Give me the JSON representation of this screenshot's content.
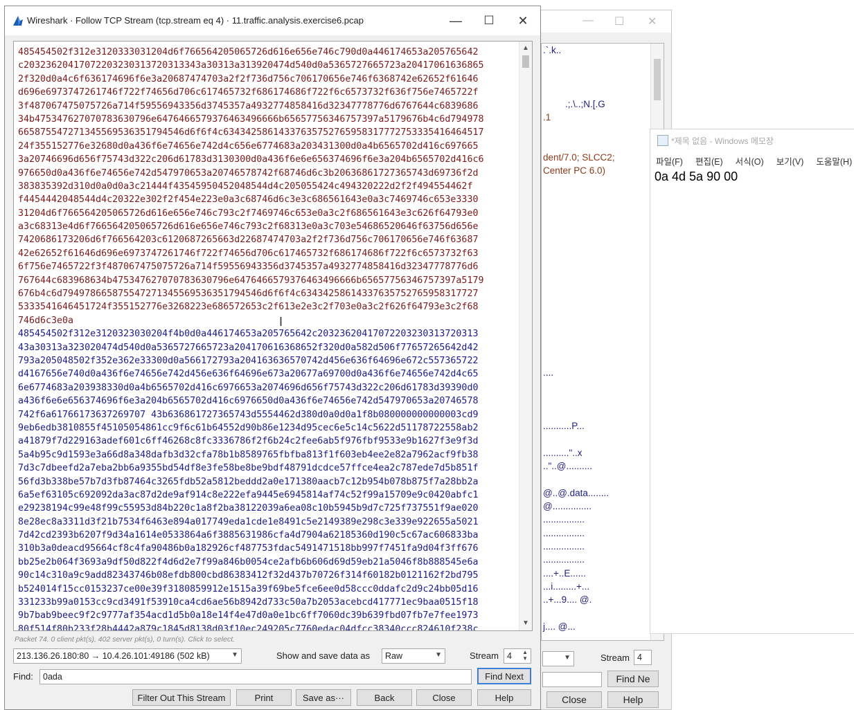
{
  "main_window": {
    "title": "Wireshark · Follow TCP Stream (tcp.stream eq 4) · 11.traffic.analysis.exercise6.pcap",
    "controls": {
      "minimize": "—",
      "maximize": "☐",
      "close": "✕"
    },
    "stream_lines": [
      {
        "side": "client",
        "text": "485454502f312e3120333031204d6f766564205065726d616e656e746c790d0a446174653a205765642"
      },
      {
        "side": "client",
        "text": "c20323620417072203230313720313343a30313a313920474d540d0a5365727665723a20417061636865"
      },
      {
        "side": "client",
        "text": "2f320d0a4c6f636174696f6e3a20687474703a2f2f736d756c706170656e746f6368742e62652f61646"
      },
      {
        "side": "client",
        "text": "d696e6973747261746f722f74656d706c617465732f686174686f722f6c6573732f636f756e7465722f"
      },
      {
        "side": "client",
        "text": "3f487067475075726a714f59556943356d3745357a4932774858416d32347778776d6767644c6839686"
      },
      {
        "side": "client",
        "text": "34b475347627070783630796e6476466579376463496666b65657756346757397a5179676b4c6d794978"
      },
      {
        "side": "client",
        "text": "665875547271345569536351794546d6f6f4c63434258614337635752765958317772753335416464517"
      },
      {
        "side": "client",
        "text": "24f355152776e32680d0a436f6e74656e742d4c656e6774683a203431300d0a4b6565702d416c697665"
      },
      {
        "side": "client",
        "text": "3a20746696d656f75743d322c206d61783d3130300d0a436f6e6e656374696f6e3a204b6565702d416c6"
      },
      {
        "side": "client",
        "text": "976650d0a436f6e74656e742d547970653a20746578742f68746d6c3b20636861727365743d69736f2d"
      },
      {
        "side": "client",
        "text": "383835392d310d0a0d0a3c21444f43545950452048544d4c205055424c494320222d2f2f494554462f"
      },
      {
        "side": "client",
        "text": "f4454442048544d4c20322e302f2f454e223e0a3c68746d6c3e3c686561643e0a3c7469746c653e3330"
      },
      {
        "side": "client",
        "text": "31204d6f766564205065726d616e656e746c793c2f7469746c653e0a3c2f686561643e3c626f64793e0"
      },
      {
        "side": "client",
        "text": "a3c68313e4d6f766564205065726d616e656e746c793c2f68313e0a3c703e54686520646f63756d656e"
      },
      {
        "side": "client",
        "text": "7420686173206d6f766564203c6120687265663d22687474703a2f2f736d756c706170656e746f63687"
      },
      {
        "side": "client",
        "text": "42e62652f61646d696e6973747261746f722f74656d706c617465732f686174686f722f6c6573732f63"
      },
      {
        "side": "client",
        "text": "6f756e7465722f3f487067475075726a714f59556943356d3745357a4932774858416d32347778776d6"
      },
      {
        "side": "client",
        "text": "767644c683968634b475347627070783630796e6476466579376463496666b65657756346757397a5179"
      },
      {
        "side": "client",
        "text": "676b4c6d794978665875547271345569536351794546d6f6f4c63434258614337635752765958317727"
      },
      {
        "side": "client",
        "text": "5333541646451724f355152776e3268223e686572653c2f613e2e3c2f703e0a3c2f626f64793e3c2f68"
      },
      {
        "side": "client",
        "text": "746d6c3e0a"
      },
      {
        "side": "server",
        "text": "485454502f312e3120323030204f4b0d0a446174653a205765642c20323620417072203230313720313"
      },
      {
        "side": "server",
        "text": "43a30313a323020474d540d0a5365727665723a204170616368652f320d0a582d506f77657265642d42"
      },
      {
        "side": "server",
        "text": "793a205048502f352e362e33300d0a566172793a204163636570742d456e636f64696e672c557365722"
      },
      {
        "side": "server",
        "text": "d4167656e740d0a436f6e74656e742d456e636f64696e673a20677a69700d0a436f6e74656e742d4c65"
      },
      {
        "side": "server",
        "text": "6e6774683a203938330d0a4b6565702d416c6976653a2074696d656f75743d322c206d61783d39390d0"
      },
      {
        "side": "server",
        "text": "a436f6e6e656374696f6e3a204b6565702d416c6976650d0a436f6e74656e742d547970653a20746578"
      },
      {
        "side": "server",
        "text": "742f6a61766173637269707 43b636861727365743d5554462d380d0a0d0a1f8b080000000000003cd9"
      },
      {
        "side": "server",
        "text": "9eb6edb3810855f45105054861cc9f6c61b64552d90b86e1234d95cec6e5c14c5622d51178722558ab2"
      },
      {
        "side": "server",
        "text": "a41879f7d229163adef601c6ff46268c8fc3336786f2f6b24c2fee6ab5f976fbf9533e9b1627f3e9f3d"
      },
      {
        "side": "server",
        "text": "5a4b95c9d1593e3a66d8a348dafb3d32cfa78b1b8589765fbfba813f1f603eb4ee2e82a7962acf9fb38"
      },
      {
        "side": "server",
        "text": "7d3c7dbeefd2a7eba2bb6a9355bd54df8e3fe58be8be9bdf48791dcdce57ffce4ea2c787ede7d5b851f"
      },
      {
        "side": "server",
        "text": "56fd3b338be57b7d3fb87464c3265fdb52a5812beddd2a0e171380aacb7c12b954b078b875f7a28bb2a"
      },
      {
        "side": "server",
        "text": "6a5ef63105c692092da3ac87d2de9af914c8e222efa9445e6945814af74c52f99a15709e9c0420abfc1"
      },
      {
        "side": "server",
        "text": "e29238194c99e48f99c55953d84b220c1a8f2ba38122039a6ea08c10b5945b9d7c725f737551f9ae020"
      },
      {
        "side": "server",
        "text": "8e28ec8a3311d3f21b7534f6463e894a017749eda1cde1e8491c5e2149389e298c3e339e922655a5021"
      },
      {
        "side": "server",
        "text": "7d42cd2393b6207f9d34a1614e0533864a6f3885631986cfa4d7904a62185360d190c5c67ac606833ba"
      },
      {
        "side": "server",
        "text": "310b3a0deacd95664cf8c4fa90486b0a182926cf487753fdac5491471518bb997f7451fa9d04f3ff676"
      },
      {
        "side": "server",
        "text": "bb25e2b064f3693a9df50d822f4d6d2e7f99a846b0054ce2afb6b606d69d59eb21a5046f8b888545e6a"
      },
      {
        "side": "server",
        "text": "90c14c310a9c9add82343746b08efdb800cbd86383412f32d437b70726f314f60182b0121162f2bd795"
      },
      {
        "side": "server",
        "text": "b524014f15cc0153237ce00e39f3180859912e1515a39f69be5fce6ee0d58ccc0ddafc2d9c24bb05d16"
      },
      {
        "side": "server",
        "text": "331233b99a0153cc9cd3491f53910ca4cd6ae56b8942d733c50a7b2053acebcd417771ec9baa0515f18"
      },
      {
        "side": "server",
        "text": "9b7bab9beec9f2c9777af354acd1d5b0a18e14f4e47d0a0e1bc6ff7060dc39b639fbd07fb7e7fee1973"
      },
      {
        "side": "server",
        "text": "80f514f80b233f28b4442a879c1845d8138d03f10ec249205c7760edac04dfcc38340ccc824610f238c"
      }
    ],
    "status": "Packet 74. 0 client pkt(s), 402 server pkt(s), 0 turn(s). Click to select.",
    "conversation": "213.136.26.180:80 → 10.4.26.101:49186 (502 kB)",
    "show_save_label": "Show and save data as",
    "show_save_value": "Raw",
    "stream_label": "Stream",
    "stream_value": "4",
    "find_label": "Find:",
    "find_value": "0ada",
    "buttons": {
      "find_next": "Find Next",
      "filter_out": "Filter Out This Stream",
      "print": "Print",
      "save_as": "Save as···",
      "back": "Back",
      "close": "Close",
      "help": "Help"
    }
  },
  "background_window": {
    "controls": {
      "minimize": "—",
      "maximize": "☐",
      "close": "✕"
    },
    "text_lines": [
      ".`.k..",
      ".;.\\..;N.[.G",
      ".1",
      "dent/7.0; SLCC2;",
      "Center PC 6.0)",
      "....",
      "...........P...",
      "..........\"..x",
      "..\"..@..........",
      "@..@.data........",
      "@...............",
      "................",
      "................",
      "................",
      "................",
      "....+..E......",
      "...i.........+...",
      "..+...9.... @.",
      "j.... @..."
    ],
    "stream_label": "Stream",
    "stream_value": "4",
    "find_next": "Find Ne",
    "close": "Close",
    "help": "Help"
  },
  "notepad": {
    "title": "*제목 없음 - Windows 메모장",
    "menu": [
      "파일(F)",
      "편집(E)",
      "서식(O)",
      "보기(V)",
      "도움말(H)"
    ],
    "content": "0a 4d 5a 90 00"
  },
  "colors": {
    "client_text": "#7b1a1a",
    "server_text": "#1c1c8c",
    "primary_button_border": "#3c7fd8"
  }
}
